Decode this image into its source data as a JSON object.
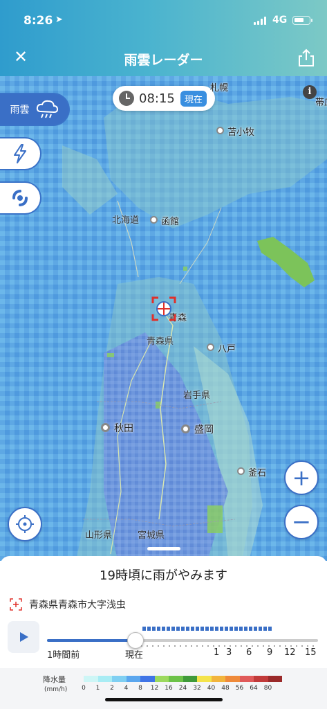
{
  "status_bar": {
    "time": "8:26",
    "network": "4G"
  },
  "header": {
    "title": "雨雲レーダー"
  },
  "time_display": {
    "time": "08:15",
    "badge": "現在"
  },
  "layers": {
    "rain_label": "雨雲"
  },
  "map_labels": {
    "cities": [
      {
        "name": "札幌"
      },
      {
        "name": "苫小牧"
      },
      {
        "name": "帯広"
      },
      {
        "name": "函館"
      },
      {
        "name": "八戸"
      },
      {
        "name": "秋田"
      },
      {
        "name": "盛岡"
      },
      {
        "name": "釜石"
      },
      {
        "name": "青森"
      }
    ],
    "prefectures": [
      "北海道",
      "青森県",
      "岩手県",
      "山形県",
      "宮城県"
    ]
  },
  "forecast": {
    "message": "19時頃に雨がやみます"
  },
  "location": {
    "address": "青森県青森市大字浅虫"
  },
  "timeline": {
    "labels": [
      "1時間前",
      "現在",
      "1",
      "3",
      "6",
      "9",
      "12",
      "15"
    ],
    "position": 0.327
  },
  "legend": {
    "title": "降水量",
    "unit": "(mm/h)",
    "levels": [
      "0",
      "1",
      "2",
      "4",
      "8",
      "12",
      "16",
      "24",
      "32",
      "40",
      "48",
      "56",
      "64",
      "80"
    ],
    "colors": [
      "#cdf6f6",
      "#a8ecf4",
      "#7fcff2",
      "#5aa6ee",
      "#3f74e6",
      "#9cd95e",
      "#6cc248",
      "#3f9a3a",
      "#f4e34a",
      "#f2b43c",
      "#ef8a3a",
      "#e05a5a",
      "#c13a3a",
      "#9a2a2a"
    ]
  },
  "colors": {
    "accent": "#3a6fc6"
  }
}
